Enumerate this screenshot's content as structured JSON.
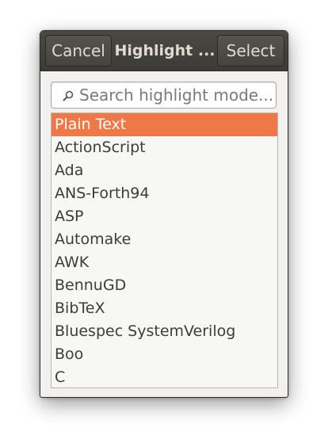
{
  "titlebar": {
    "cancel_label": "Cancel",
    "title": "Highlight ...",
    "select_label": "Select"
  },
  "search": {
    "placeholder": "Search highlight mode..."
  },
  "list": {
    "items": [
      {
        "label": "Plain Text",
        "selected": true
      },
      {
        "label": "ActionScript"
      },
      {
        "label": "Ada"
      },
      {
        "label": "ANS-Forth94"
      },
      {
        "label": "ASP"
      },
      {
        "label": "Automake"
      },
      {
        "label": "AWK"
      },
      {
        "label": "BennuGD"
      },
      {
        "label": "BibTeX"
      },
      {
        "label": "Bluespec SystemVerilog"
      },
      {
        "label": "Boo"
      },
      {
        "label": "C"
      }
    ]
  },
  "colors": {
    "selection": "#f07746",
    "titlebar": "#3c3b37",
    "titlebar_text": "#dfdbd2"
  },
  "icons": {
    "search": "search-icon"
  }
}
